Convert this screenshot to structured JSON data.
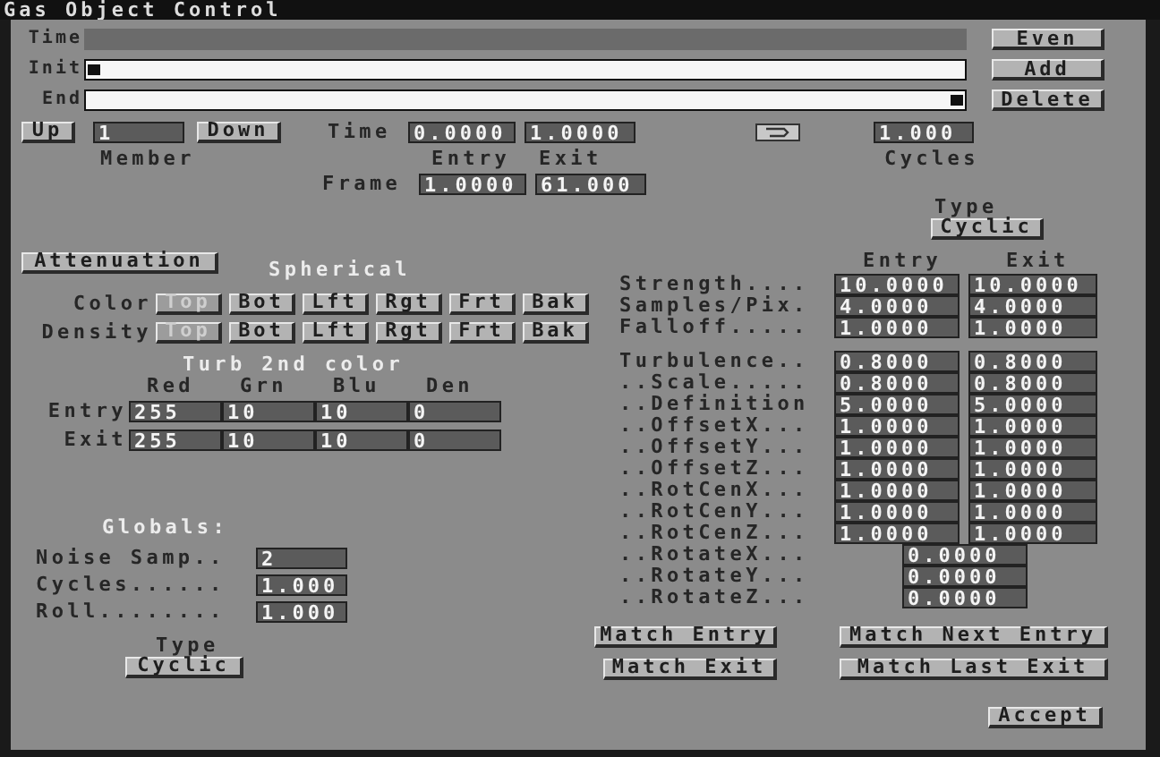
{
  "window": {
    "title": "Gas Object Control"
  },
  "timeline": {
    "time_label": "Time",
    "init_label": "Init",
    "end_label": "End",
    "init": {
      "level": 0
    },
    "end": {
      "level": 1
    }
  },
  "side_buttons": [
    "Even",
    "Add",
    "Delete"
  ],
  "member": {
    "up": "Up",
    "value": "1",
    "down": "Down",
    "label": "Member"
  },
  "time_frame": {
    "time_label": "Time",
    "frame_label": "Frame",
    "entry_label": "Entry",
    "exit_label": "Exit",
    "time_entry": "0.0000",
    "time_exit": "1.0000",
    "frame_entry": "1.0000",
    "frame_exit": "61.000"
  },
  "cycles": {
    "value": "1.000",
    "label": "Cycles"
  },
  "type": {
    "label": "Type",
    "value": "Cyclic"
  },
  "attenuation": {
    "button": "Attenuation",
    "mode": "Spherical"
  },
  "faces": [
    {
      "label": "Color",
      "buttons": [
        {
          "label": "Top",
          "disabled": true
        },
        {
          "label": "Bot",
          "disabled": false
        },
        {
          "label": "Lft",
          "disabled": false
        },
        {
          "label": "Rgt",
          "disabled": false
        },
        {
          "label": "Frt",
          "disabled": false
        },
        {
          "label": "Bak",
          "disabled": false
        }
      ]
    },
    {
      "label": "Density",
      "buttons": [
        {
          "label": "Top",
          "disabled": true
        },
        {
          "label": "Bot",
          "disabled": false
        },
        {
          "label": "Lft",
          "disabled": false
        },
        {
          "label": "Rgt",
          "disabled": false
        },
        {
          "label": "Frt",
          "disabled": false
        },
        {
          "label": "Bak",
          "disabled": false
        }
      ]
    }
  ],
  "turb_color": {
    "title": "Turb 2nd color",
    "columns": [
      "Red",
      "Grn",
      "Blu",
      "Den"
    ],
    "rows": [
      {
        "label": "Entry",
        "values": [
          "255",
          "10",
          "10",
          "0"
        ]
      },
      {
        "label": "Exit",
        "values": [
          "255",
          "10",
          "10",
          "0"
        ]
      }
    ]
  },
  "globals": {
    "title": "Globals:",
    "rows": [
      {
        "label": "Noise Samp..",
        "value": "2"
      },
      {
        "label": "Cycles......",
        "value": "1.000"
      },
      {
        "label": "Roll........",
        "value": "1.000"
      }
    ],
    "type_label": "Type",
    "type_value": "Cyclic"
  },
  "params": {
    "entry_heading": "Entry",
    "exit_heading": "Exit",
    "groups": [
      [
        {
          "kind": "pair",
          "label": "Strength....",
          "entry": "10.0000",
          "exit": "10.0000"
        },
        {
          "kind": "pair",
          "label": "Samples/Pix.",
          "entry": "4.0000",
          "exit": "4.0000"
        },
        {
          "kind": "pair",
          "label": "Falloff.....",
          "entry": "1.0000",
          "exit": "1.0000"
        }
      ],
      [
        {
          "kind": "pair",
          "label": "Turbulence..",
          "entry": "0.8000",
          "exit": "0.8000"
        },
        {
          "kind": "pair",
          "label": "..Scale.....",
          "entry": "0.8000",
          "exit": "0.8000"
        },
        {
          "kind": "pair",
          "label": "..Definition",
          "entry": "5.0000",
          "exit": "5.0000"
        },
        {
          "kind": "pair",
          "label": "..OffsetX...",
          "entry": "1.0000",
          "exit": "1.0000"
        },
        {
          "kind": "pair",
          "label": "..OffsetY...",
          "entry": "1.0000",
          "exit": "1.0000"
        },
        {
          "kind": "pair",
          "label": "..OffsetZ...",
          "entry": "1.0000",
          "exit": "1.0000"
        },
        {
          "kind": "pair",
          "label": "..RotCenX...",
          "entry": "1.0000",
          "exit": "1.0000"
        },
        {
          "kind": "pair",
          "label": "..RotCenY...",
          "entry": "1.0000",
          "exit": "1.0000"
        },
        {
          "kind": "pair",
          "label": "..RotCenZ...",
          "entry": "1.0000",
          "exit": "1.0000"
        },
        {
          "kind": "single",
          "label": "..RotateX...",
          "value": "0.0000"
        },
        {
          "kind": "single",
          "label": "..RotateY...",
          "value": "0.0000"
        },
        {
          "kind": "single",
          "label": "..RotateZ...",
          "value": "0.0000"
        }
      ]
    ]
  },
  "match_buttons": [
    "Match Entry",
    "Match Next Entry",
    "Match Exit",
    "Match Last Exit"
  ],
  "accept": "Accept"
}
